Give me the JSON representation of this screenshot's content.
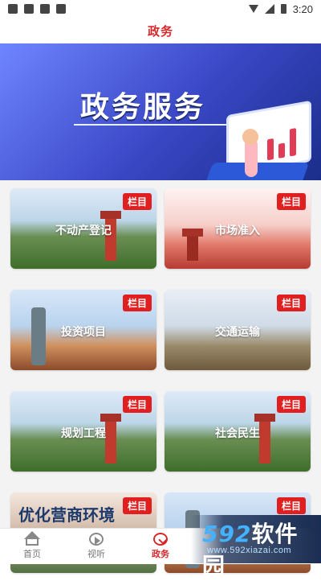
{
  "status_bar": {
    "time": "3:20"
  },
  "header": {
    "title": "政务"
  },
  "banner": {
    "title": "政务服务"
  },
  "cards": [
    {
      "label": "不动产登记",
      "badge": "栏目"
    },
    {
      "label": "市场准入",
      "badge": "栏目"
    },
    {
      "label": "投资项目",
      "badge": "栏目"
    },
    {
      "label": "交通运输",
      "badge": "栏目"
    },
    {
      "label": "规划工程",
      "badge": "栏目"
    },
    {
      "label": "社会民生",
      "badge": "栏目"
    },
    {
      "label": "优化营商环境",
      "badge": "栏目"
    },
    {
      "label": "",
      "badge": "栏目"
    }
  ],
  "bottom_nav": [
    {
      "label": "首页",
      "icon": "home-icon"
    },
    {
      "label": "视听",
      "icon": "play-icon"
    },
    {
      "label": "政务",
      "icon": "gov-icon"
    }
  ],
  "watermark": {
    "logo_num": "592",
    "logo_text": "软件园",
    "url": "www.592xiazai.com"
  }
}
